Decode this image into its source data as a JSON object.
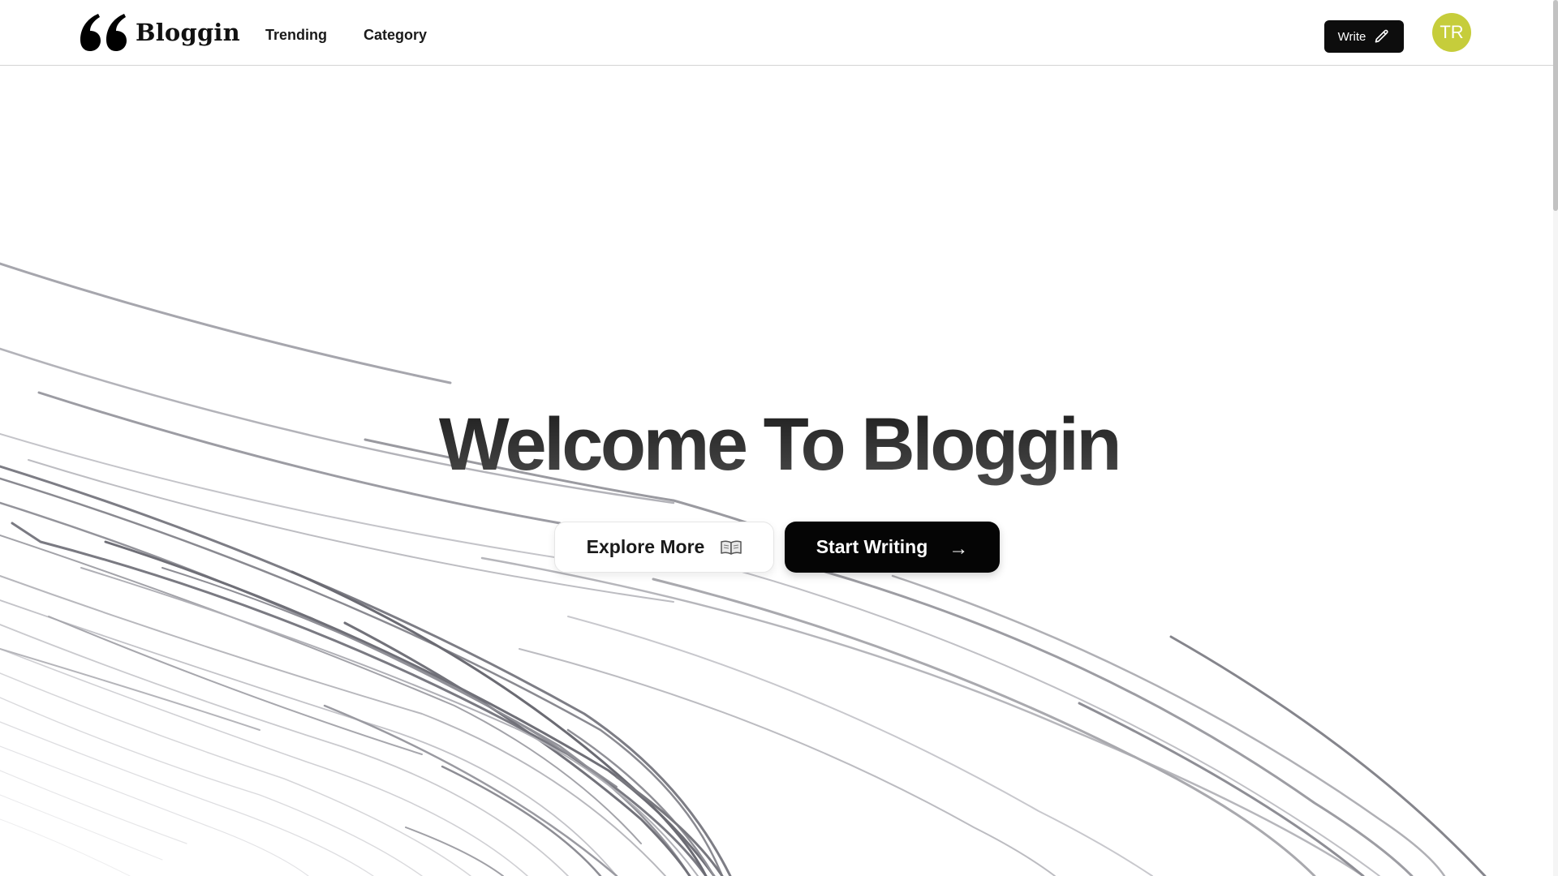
{
  "header": {
    "logo_text": "Bloggin",
    "nav": [
      {
        "label": "Trending"
      },
      {
        "label": "Category"
      }
    ],
    "write_label": "Write",
    "avatar_initials": "TR",
    "avatar_color": "#c6cd3b"
  },
  "hero": {
    "title": "Welcome To Bloggin",
    "explore_label": "Explore More",
    "start_label": "Start Writing",
    "start_arrow": "→"
  },
  "icons": {
    "logo": "double-quote-icon",
    "write": "pencil-icon",
    "explore": "open-book-icon",
    "start": "arrow-right-icon"
  }
}
